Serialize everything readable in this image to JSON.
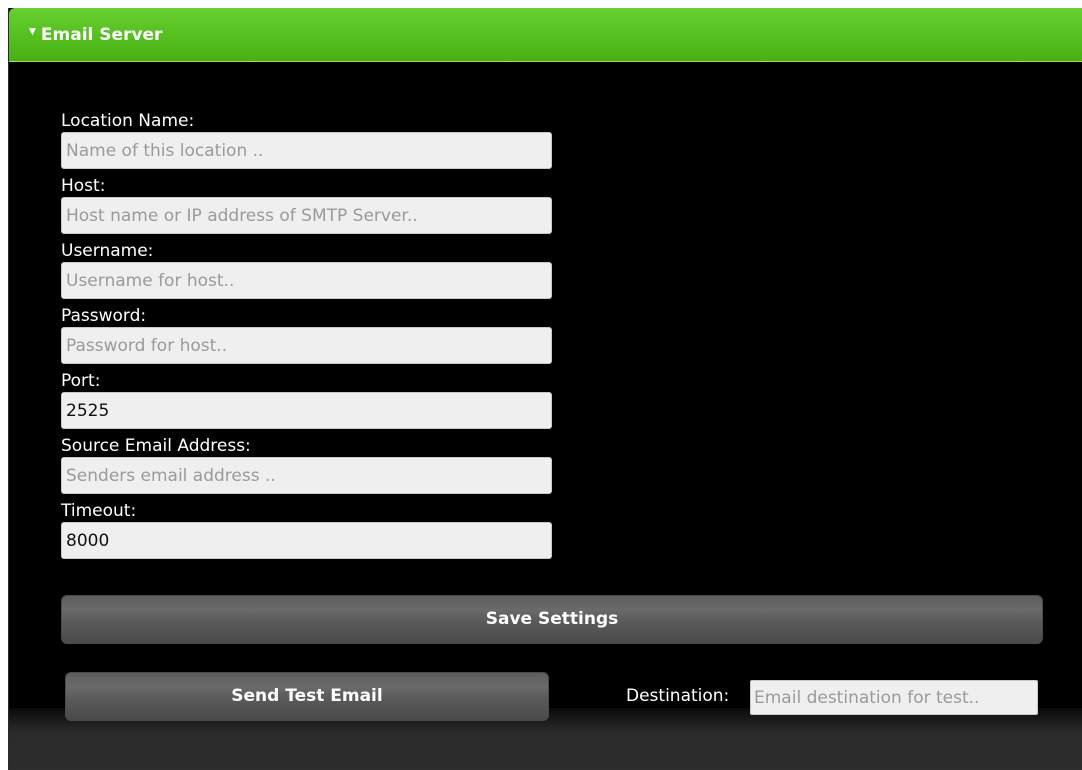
{
  "header": {
    "title": "Email Server",
    "collapse_icon": "triangle-down"
  },
  "form": {
    "location_name": {
      "label": "Location Name:",
      "value": "",
      "placeholder": "Name of this location .."
    },
    "host": {
      "label": "Host:",
      "value": "",
      "placeholder": "Host name or IP address of SMTP Server.."
    },
    "username": {
      "label": "Username:",
      "value": "",
      "placeholder": "Username for host.."
    },
    "password": {
      "label": "Password:",
      "value": "",
      "placeholder": "Password for host.."
    },
    "port": {
      "label": "Port:",
      "value": "2525",
      "placeholder": ""
    },
    "source_email": {
      "label": "Source Email Address:",
      "value": "",
      "placeholder": "Senders email address .."
    },
    "timeout": {
      "label": "Timeout:",
      "value": "8000",
      "placeholder": ""
    }
  },
  "actions": {
    "save_label": "Save Settings",
    "test_label": "Send Test Email",
    "destination_label": "Destination:",
    "destination_placeholder": "Email destination for test.."
  },
  "colors": {
    "header_green": "#55bf1f",
    "panel_background": "#000000",
    "button_gray": "#5e5e5e",
    "input_background": "#efefef"
  }
}
